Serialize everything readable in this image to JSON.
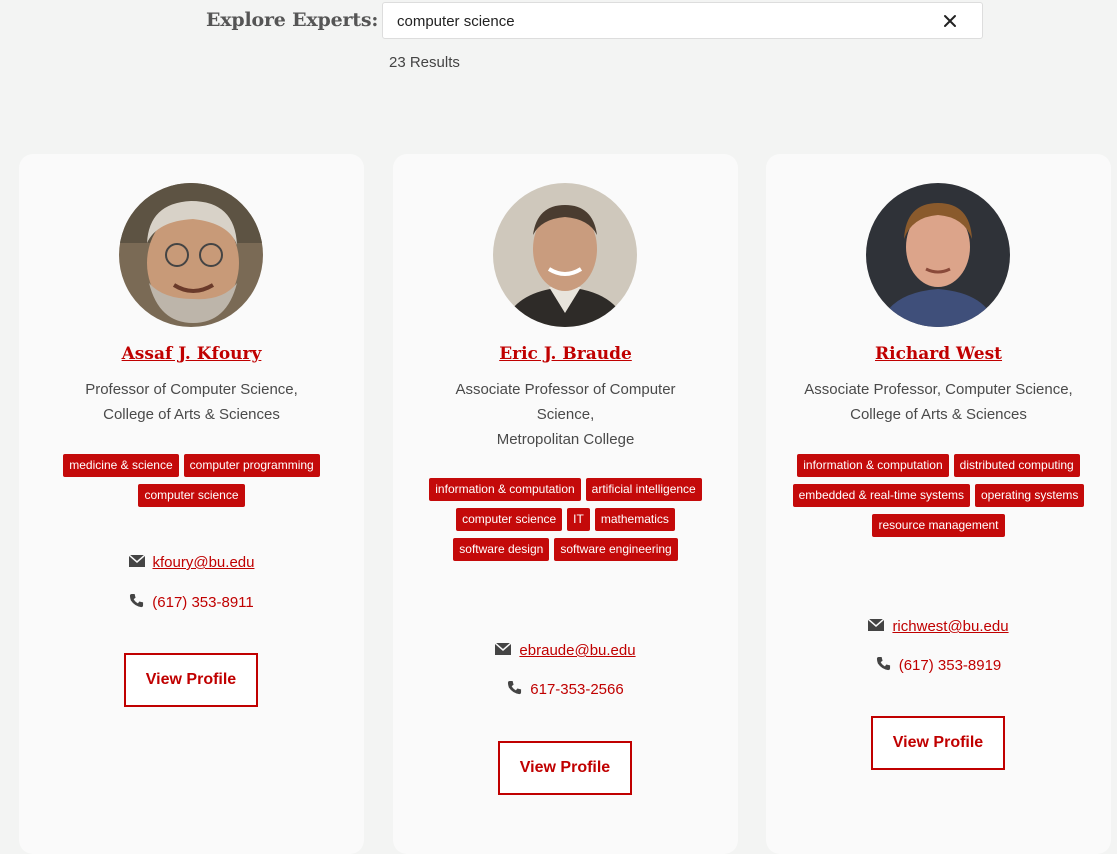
{
  "search": {
    "label": "Explore Experts:",
    "value": "computer science",
    "result_count": "23 Results"
  },
  "experts": [
    {
      "name": "Assaf J. Kfoury",
      "title_lines": [
        "Professor of Computer Science,",
        "College of Arts & Sciences"
      ],
      "tags": [
        "medicine & science",
        "computer programming",
        "computer science"
      ],
      "email": "kfoury@bu.edu",
      "phone": "(617) 353-8911",
      "button": "View Profile"
    },
    {
      "name": "Eric J. Braude",
      "title_lines": [
        "Associate Professor of Computer",
        "Science,",
        "Metropolitan College"
      ],
      "tags": [
        "information & computation",
        "artificial intelligence",
        "computer science",
        "IT",
        "mathematics",
        "software design",
        "software engineering"
      ],
      "email": "ebraude@bu.edu",
      "phone": "617-353-2566",
      "button": "View Profile"
    },
    {
      "name": "Richard West",
      "title_lines": [
        "Associate Professor, Computer Science,",
        "College of Arts & Sciences"
      ],
      "tags": [
        "information & computation",
        "distributed computing",
        "embedded & real-time systems",
        "operating systems",
        "resource management"
      ],
      "email": "richwest@bu.edu",
      "phone": "(617) 353-8919",
      "button": "View Profile"
    }
  ],
  "colors": {
    "accent": "#c00000",
    "tag_bg": "#c40a0a",
    "page_bg": "#f3f4f3",
    "card_bg": "#fafafa"
  },
  "icons": {
    "clear": "close-icon",
    "email": "envelope-icon",
    "phone": "phone-icon"
  }
}
